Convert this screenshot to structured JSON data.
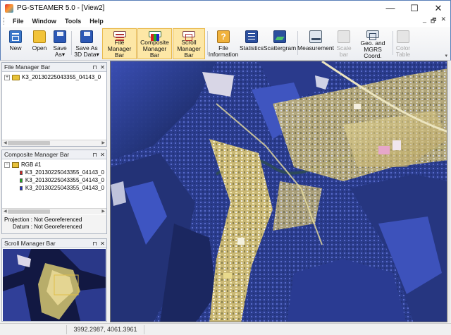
{
  "window": {
    "title": "PG-STEAMER 5.0 - [View2]",
    "minimize": "—",
    "maximize": "☐",
    "close": "✕"
  },
  "menu": {
    "items": [
      "File",
      "Window",
      "Tools",
      "Help"
    ],
    "right_min": "_",
    "right_restore": "🗗",
    "right_close": "✕"
  },
  "toolbar": {
    "buttons": [
      {
        "label": "New",
        "icon": "new-icon",
        "state": "normal"
      },
      {
        "label": "Open",
        "icon": "open-folder-icon",
        "state": "normal"
      },
      {
        "label": "Save\nAs▾",
        "icon": "save-icon",
        "state": "normal"
      },
      {
        "label": "Save As\n3D Data▾",
        "icon": "save-3d-icon",
        "state": "normal"
      },
      {
        "label": "File Manager\nBar",
        "icon": "file-manager-icon",
        "state": "active"
      },
      {
        "label": "Composite\nManager Bar",
        "icon": "composite-manager-icon",
        "state": "active"
      },
      {
        "label": "Scroll\nManager Bar",
        "icon": "scroll-manager-icon",
        "state": "active"
      },
      {
        "label": "File\nInformation",
        "icon": "file-info-icon",
        "state": "normal"
      },
      {
        "label": "Statistics",
        "icon": "statistics-icon",
        "state": "normal"
      },
      {
        "label": "Scattergram",
        "icon": "scattergram-icon",
        "state": "normal"
      },
      {
        "label": "Measurement",
        "icon": "measurement-icon",
        "state": "normal"
      },
      {
        "label": "Scale\nbar",
        "icon": "scale-bar-icon",
        "state": "disabled"
      },
      {
        "label": "Geo. and\nMGRS Coord.",
        "icon": "geo-coord-icon",
        "state": "normal"
      },
      {
        "label": "Color\nTable",
        "icon": "color-table-icon",
        "state": "disabled"
      }
    ]
  },
  "file_manager": {
    "title": "File Manager Bar",
    "pin": "⊓",
    "close": "✕",
    "expander": "+",
    "file": "K3_20130225043355_04143_0"
  },
  "composite_manager": {
    "title": "Composite Manager Bar",
    "pin": "⊓",
    "close": "✕",
    "expander": "−",
    "group": "RGB #1",
    "bands": [
      {
        "label": "K3_20130225043355_04143_0",
        "color": "#d22020"
      },
      {
        "label": "K3_20130225043355_04143_0",
        "color": "#1aa51a"
      },
      {
        "label": "K3_20130225043355_04143_0",
        "color": "#1c2fc4"
      }
    ],
    "projection": "Projection : Not Georeferenced",
    "datum": "Datum : Not Georeferenced"
  },
  "scroll_manager": {
    "title": "Scroll Manager Bar",
    "pin": "⊓",
    "close": "✕"
  },
  "status": {
    "coords": "3992.2987, 4061.3961"
  },
  "colors": {
    "accent_border": "#5a7fb8",
    "active_button_bg": "#fde7a6",
    "terrain_blue": "#2c3d95",
    "urban_yellow": "#e8d686"
  }
}
